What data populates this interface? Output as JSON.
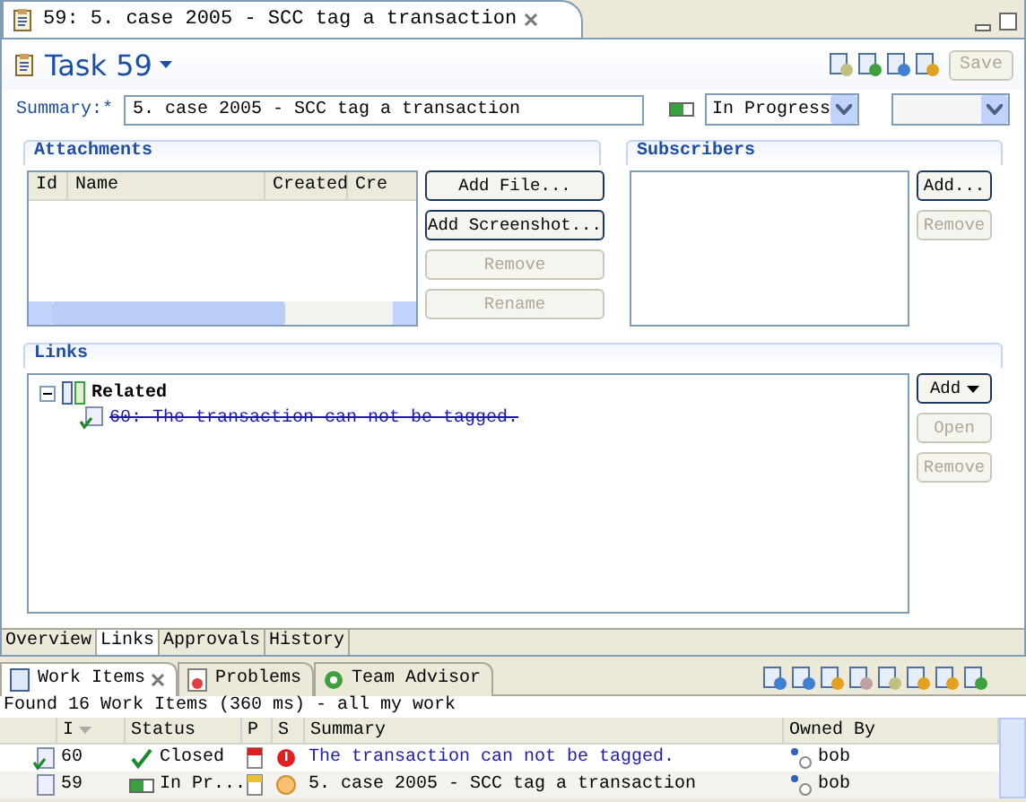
{
  "editor_tab": {
    "title": "59: 5. case 2005 - SCC tag a transaction",
    "selected": true
  },
  "header": {
    "title": "Task 59",
    "save_button": {
      "label": "Save",
      "disabled": true
    }
  },
  "summary": {
    "label": "Summary:*",
    "value": "5. case 2005 - SCC tag a transaction",
    "state": "In Progress"
  },
  "attachments": {
    "title": "Attachments",
    "columns": [
      "Id",
      "Name",
      "Created",
      "Cre"
    ],
    "buttons": [
      {
        "label": "Add File...",
        "disabled": false
      },
      {
        "label": "Add Screenshot...",
        "disabled": false
      },
      {
        "label": "Remove",
        "disabled": true
      },
      {
        "label": "Rename",
        "disabled": true
      }
    ]
  },
  "subscribers": {
    "title": "Subscribers",
    "buttons": [
      {
        "label": "Add...",
        "disabled": false
      },
      {
        "label": "Remove",
        "disabled": true
      }
    ]
  },
  "links": {
    "title": "Links",
    "tree": [
      {
        "label": "Related",
        "expanded": true,
        "children": [
          {
            "label": "60: The transaction can not be tagged.",
            "resolved": true
          }
        ]
      }
    ],
    "buttons": [
      {
        "label": "Add",
        "disabled": false,
        "menu": true
      },
      {
        "label": "Open",
        "disabled": true,
        "menu": false
      },
      {
        "label": "Remove",
        "disabled": true,
        "menu": false
      }
    ]
  },
  "page_tabs": [
    {
      "label": "Overview",
      "selected": false
    },
    {
      "label": "Links",
      "selected": true
    },
    {
      "label": "Approvals",
      "selected": false
    },
    {
      "label": "History",
      "selected": false
    }
  ],
  "views": [
    {
      "label": "Work Items",
      "selected": true,
      "kind": "items"
    },
    {
      "label": "Problems",
      "selected": false,
      "kind": "problems"
    },
    {
      "label": "Team Advisor",
      "selected": false,
      "kind": "advisor"
    }
  ],
  "work_items": {
    "status_line": "Found 16 Work Items (360 ms) - all my work",
    "columns": [
      "I",
      "Status",
      "P",
      "S",
      "Summary",
      "Owned By"
    ],
    "rows": [
      {
        "id": "60",
        "status": "Closed",
        "kind": "closed",
        "priority": {
          "color": "#d82020"
        },
        "severity": {
          "kind": "critical"
        },
        "summary": "The transaction can not be tagged.",
        "owner": "bob"
      },
      {
        "id": "59",
        "status": "In Pr...",
        "kind": "in_progress",
        "priority": {
          "color": "#e8c030"
        },
        "severity": {
          "kind": "normal"
        },
        "summary": "5. case 2005 - SCC tag a transaction",
        "owner": "bob"
      }
    ]
  }
}
